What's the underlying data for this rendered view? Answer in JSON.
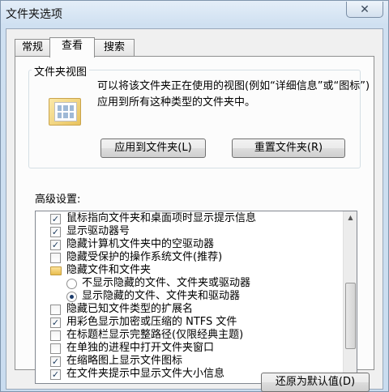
{
  "window": {
    "title": "文件夹选项",
    "close_glyph": "✕"
  },
  "tabs": [
    {
      "label": "常规",
      "active": false
    },
    {
      "label": "查看",
      "active": true
    },
    {
      "label": "搜索",
      "active": false
    }
  ],
  "folder_views": {
    "title": "文件夹视图",
    "description": "可以将该文件夹正在使用的视图(例如“详细信息”或“图标”)应用到所有这种类型的文件夹中。",
    "apply_button": "应用到文件夹(L)",
    "reset_button": "重置文件夹(R)"
  },
  "advanced": {
    "title": "高级设置:",
    "items": [
      {
        "type": "checkbox",
        "label": "鼠标指向文件夹和桌面项时显示提示信息",
        "checked": true
      },
      {
        "type": "checkbox",
        "label": "显示驱动器号",
        "checked": true
      },
      {
        "type": "checkbox",
        "label": "隐藏计算机文件夹中的空驱动器",
        "checked": true
      },
      {
        "type": "checkbox",
        "label": "隐藏受保护的操作系统文件(推荐)",
        "checked": false
      },
      {
        "type": "folder",
        "label": "隐藏文件和文件夹"
      },
      {
        "type": "radio",
        "label": "不显示隐藏的文件、文件夹或驱动器",
        "checked": false
      },
      {
        "type": "radio",
        "label": "显示隐藏的文件、文件夹和驱动器",
        "checked": true
      },
      {
        "type": "checkbox",
        "label": "隐藏已知文件类型的扩展名",
        "checked": false
      },
      {
        "type": "checkbox",
        "label": "用彩色显示加密或压缩的 NTFS 文件",
        "checked": true
      },
      {
        "type": "checkbox",
        "label": "在标题栏显示完整路径(仅限经典主题)",
        "checked": false
      },
      {
        "type": "checkbox",
        "label": "在单独的进程中打开文件夹窗口",
        "checked": false
      },
      {
        "type": "checkbox",
        "label": "在缩略图上显示文件图标",
        "checked": true
      },
      {
        "type": "checkbox",
        "label": "在文件夹提示中显示文件大小信息",
        "checked": true
      }
    ],
    "check_glyph": "✓",
    "restore_button": "还原为默认值(D)"
  }
}
